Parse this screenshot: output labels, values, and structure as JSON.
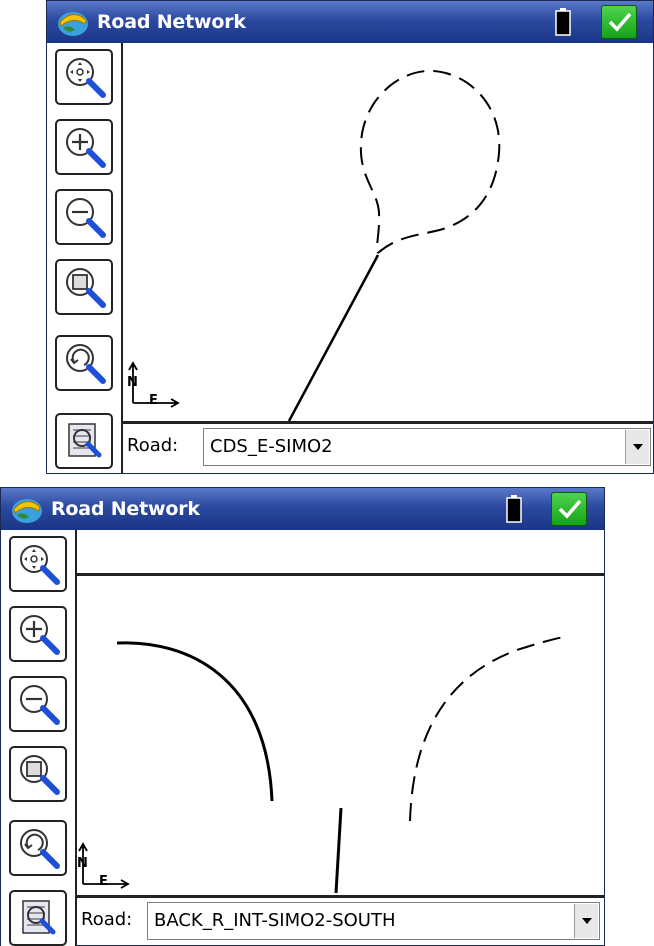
{
  "screen1": {
    "title": "Road Network",
    "road_label": "Road:",
    "road_value": "CDS_E-SIMO2",
    "compass": {
      "north": "N",
      "east": "E"
    }
  },
  "screen2": {
    "title": "Road Network",
    "road_label": "Road:",
    "road_value": "BACK_R_INT-SIMO2-SOUTH",
    "compass": {
      "north": "N",
      "east": "E"
    }
  },
  "toolbar_icons": [
    "zoom-extents-icon",
    "zoom-in-icon",
    "zoom-out-icon",
    "zoom-window-icon",
    "zoom-previous-icon",
    "zoom-settings-icon"
  ],
  "colors": {
    "titlebar": "#2b4aa0",
    "ok_button": "#16a316",
    "line": "#000000"
  }
}
